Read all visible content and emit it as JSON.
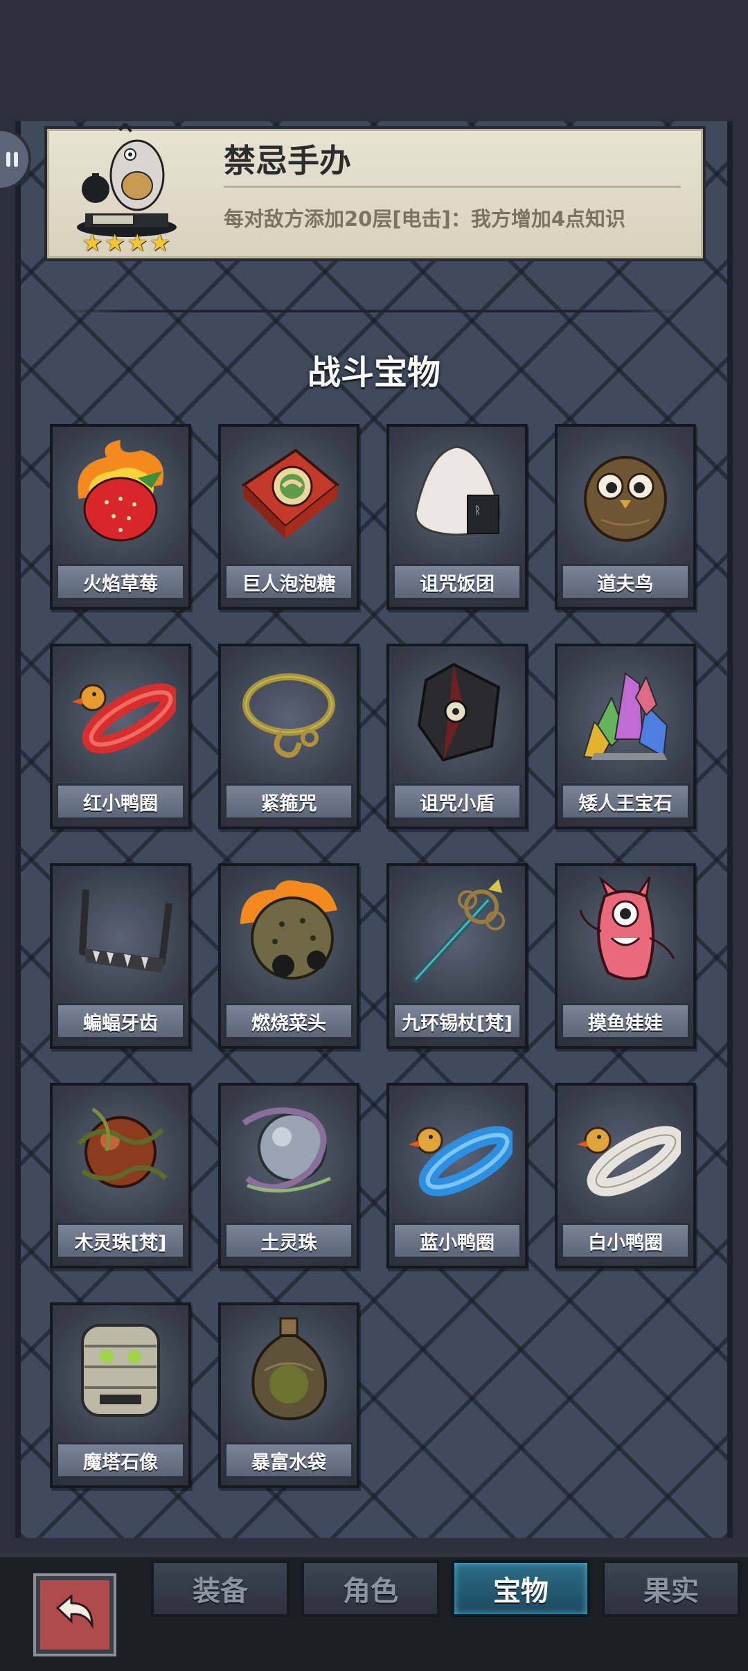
{
  "info_card": {
    "title": "禁忌手办",
    "description": "每对敌方添加20层[电击]：我方增加4点知识",
    "stars": [
      "★",
      "★",
      "★",
      "★"
    ]
  },
  "section_title": "战斗宝物",
  "items": [
    {
      "label": "火焰草莓",
      "icon": "flame-strawberry-icon"
    },
    {
      "label": "巨人泡泡糖",
      "icon": "giant-bubblegum-icon"
    },
    {
      "label": "诅咒饭团",
      "icon": "cursed-riceball-icon"
    },
    {
      "label": "道夫鸟",
      "icon": "owl-icon"
    },
    {
      "label": "红小鸭圈",
      "icon": "red-duck-ring-icon"
    },
    {
      "label": "紧箍咒",
      "icon": "golden-headband-icon"
    },
    {
      "label": "诅咒小盾",
      "icon": "cursed-shield-icon"
    },
    {
      "label": "矮人王宝石",
      "icon": "dwarf-gems-icon"
    },
    {
      "label": "蝙蝠牙齿",
      "icon": "bat-fang-icon"
    },
    {
      "label": "燃烧菜头",
      "icon": "burning-bomb-icon"
    },
    {
      "label": "九环锡杖[梵]",
      "icon": "nine-ring-staff-icon"
    },
    {
      "label": "摸鱼娃娃",
      "icon": "pink-doll-icon"
    },
    {
      "label": "木灵珠[梵]",
      "icon": "wood-orb-icon"
    },
    {
      "label": "土灵珠",
      "icon": "earth-orb-icon"
    },
    {
      "label": "蓝小鸭圈",
      "icon": "blue-duck-ring-icon"
    },
    {
      "label": "白小鸭圈",
      "icon": "white-duck-ring-icon"
    },
    {
      "label": "魔塔石像",
      "icon": "tower-statue-icon"
    },
    {
      "label": "暴富水袋",
      "icon": "water-pouch-icon"
    }
  ],
  "tabs": [
    {
      "label": "装备",
      "active": false
    },
    {
      "label": "角色",
      "active": false
    },
    {
      "label": "宝物",
      "active": true
    },
    {
      "label": "果实",
      "active": false
    }
  ],
  "back_icon": "back-arrow-icon"
}
